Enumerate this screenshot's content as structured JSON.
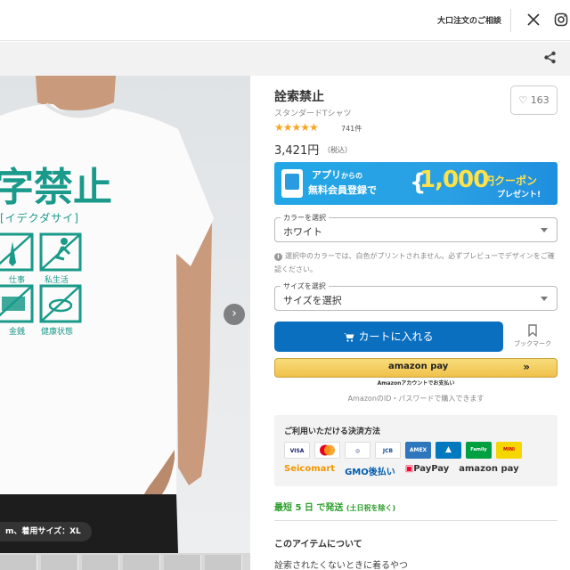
{
  "header": {
    "bulk_order_label": "大口注文のご相談",
    "x_icon": "x-logo-icon",
    "instagram_icon": "instagram-icon"
  },
  "subbar": {
    "share_icon": "share-icon"
  },
  "product_image": {
    "print_title": "字禁止",
    "print_subtitle": "イデクダサイ",
    "print_items": [
      "仕事",
      "私生活",
      "金銭",
      "健康状態"
    ],
    "size_caption": "m、着用サイズ：XL",
    "next_icon": "chevron-right-icon"
  },
  "product": {
    "title": "詮索禁止",
    "subtitle": "スタンダードTシャツ",
    "stars": "★★★★★",
    "rating": 4.5,
    "review_count": "741件",
    "favorite_count": "163",
    "price": "3,421円",
    "tax_label": "（税込）"
  },
  "promo": {
    "line1": "アプリ",
    "line1_suffix": "からの",
    "line2": "無料会員登録で",
    "amount": "1,000",
    "coupon": "円クーポン",
    "gift": "プレゼント!"
  },
  "color_select": {
    "label": "カラーを選択",
    "value": "ホワイト"
  },
  "color_notice": "選択中のカラーでは、白色がプリントされません。必ずプレビューでデザインをご確認ください。",
  "size_select": {
    "label": "サイズを選択",
    "value": "サイズを選択"
  },
  "cart": {
    "label": "カートに入れる",
    "bookmark_label": "ブックマーク"
  },
  "amazon": {
    "button_label": "amazon pay",
    "caption": "Amazonアカウントでお支払い",
    "note": "AmazonのID・パスワードで購入できます"
  },
  "payment": {
    "title": "ご利用いただける決済方法",
    "cards": [
      "VISA",
      "MC",
      "DC",
      "JCB",
      "AMEX",
      "Diners",
      "Family",
      "MINI"
    ],
    "methods": [
      "Seicomart",
      "GMO後払い",
      "PayPay",
      "amazon pay"
    ]
  },
  "shipping": {
    "text": "最短 5 日 で発送",
    "note": "(土日祝を除く)"
  },
  "about": {
    "title": "このアイテムについて",
    "body": "詮索されたくないときに着るやつ"
  },
  "colors": {
    "accent": "#0b6fbf",
    "shipping": "#2a9d2a",
    "star": "#f5a623",
    "print": "#1a9a8a"
  }
}
